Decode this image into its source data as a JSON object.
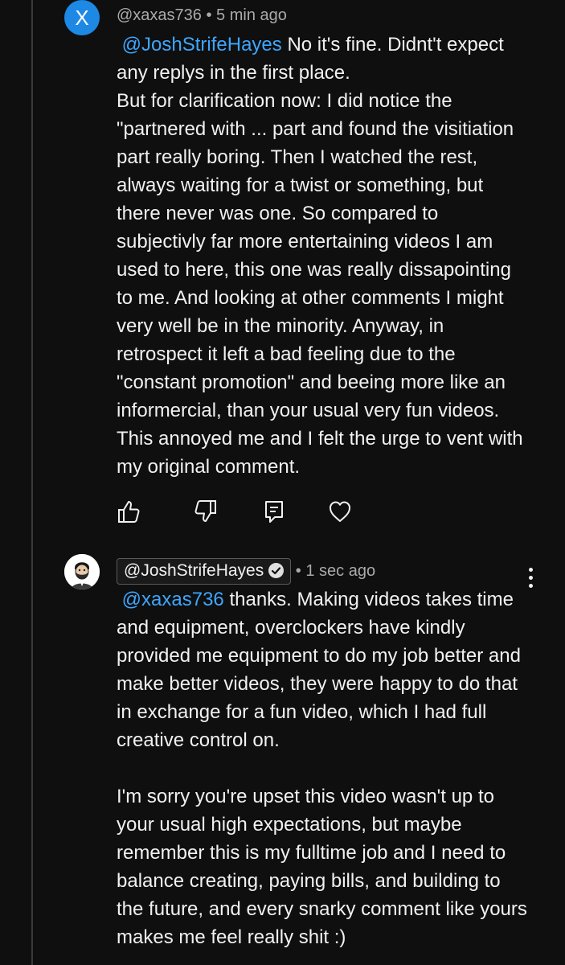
{
  "comment1": {
    "avatar_letter": "X",
    "avatar_color": "#1e88e5",
    "handle": "@xaxas736",
    "time": "5 min ago",
    "mention": "@JoshStrifeHayes",
    "lines": [
      " No it's fine. Didnt't expect",
      "any replys in the first place.",
      "But for clarification now: I did notice the",
      "\"partnered with ... part and found the visitiation",
      "part really boring. Then I watched the rest,",
      "always waiting for a twist or something, but",
      "there never was one. So compared to",
      "subjectivly far more entertaining videos I am",
      "used to here, this one was really dissapointing",
      "to me. And looking at other comments I might",
      "very well be in the minority. Anyway, in",
      "retrospect it left a bad feeling due to the",
      "\"constant promotion\" and beeing more like an",
      "informercial, than your usual very fun videos.",
      "This annoyed me and I felt the urge to vent with",
      "my original comment."
    ],
    "actions": {
      "like_icon": "thumbs-up-icon",
      "dislike_icon": "thumbs-down-icon",
      "reply_icon": "comment-reply-icon",
      "heart_icon": "heart-icon"
    }
  },
  "comment2": {
    "avatar_icon": "bearded-man-avatar",
    "handle": "@JoshStrifeHayes",
    "verified_icon": "verified-check-icon",
    "time": "• 1 sec ago",
    "mention": "@xaxas736",
    "lines": [
      " thanks. Making videos takes time",
      "and equipment, overclockers have kindly",
      "provided me equipment to do my job better and",
      "make better videos, they were happy to do that",
      "in exchange for a fun video, which I had full",
      "creative control on."
    ],
    "lines2": [
      "I'm sorry you're upset this video wasn't up to",
      "your usual high expectations, but maybe",
      "remember this is my fulltime job and I need to",
      "balance creating, paying bills, and building to",
      "the future, and every snarky comment like yours",
      "makes me feel really shit :)"
    ],
    "menu_icon": "more-vertical-icon"
  },
  "colors": {
    "background": "#0f0f0f",
    "text": "#f1f1f1",
    "secondary_text": "#aaaaaa",
    "mention": "#3ea6ff"
  }
}
